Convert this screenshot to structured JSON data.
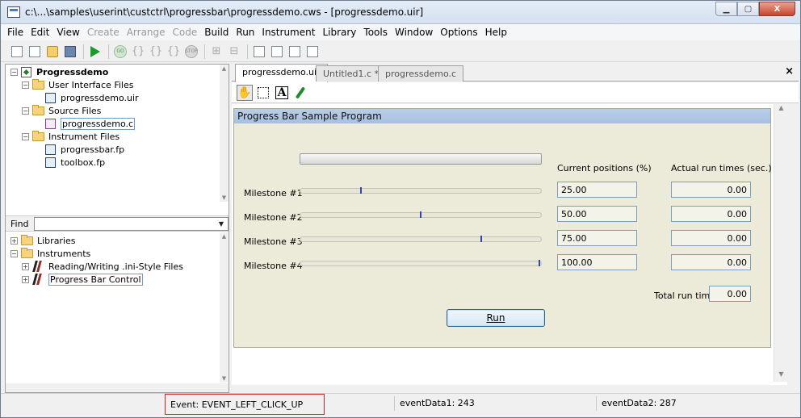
{
  "window": {
    "title": "c:\\...\\samples\\userint\\custctrl\\progressbar\\progressdemo.cws - [progressdemo.uir]",
    "controls": {
      "minimize": "▁",
      "maximize": "▢",
      "close": "X"
    }
  },
  "menu": [
    {
      "label": "File",
      "enabled": true
    },
    {
      "label": "Edit",
      "enabled": true
    },
    {
      "label": "View",
      "enabled": true
    },
    {
      "label": "Create",
      "enabled": false
    },
    {
      "label": "Arrange",
      "enabled": false
    },
    {
      "label": "Code",
      "enabled": false
    },
    {
      "label": "Build",
      "enabled": true
    },
    {
      "label": "Run",
      "enabled": true
    },
    {
      "label": "Instrument",
      "enabled": true
    },
    {
      "label": "Library",
      "enabled": true
    },
    {
      "label": "Tools",
      "enabled": true
    },
    {
      "label": "Window",
      "enabled": true
    },
    {
      "label": "Options",
      "enabled": true
    },
    {
      "label": "Help",
      "enabled": true
    }
  ],
  "project_tree": {
    "workspace": "Progressdemo",
    "folders": [
      {
        "label": "User Interface Files",
        "files": [
          "progressdemo.uir"
        ]
      },
      {
        "label": "Source Files",
        "files": [
          "progressdemo.c"
        ]
      },
      {
        "label": "Instrument Files",
        "files": [
          "progressbar.fp",
          "toolbox.fp"
        ]
      }
    ]
  },
  "find": {
    "label": "Find",
    "value": ""
  },
  "library_tree": {
    "items": [
      "Libraries",
      "Instruments"
    ],
    "instruments": [
      "Reading/Writing .ini-Style Files",
      "Progress Bar Control"
    ]
  },
  "tabs": [
    "progressdemo.uir",
    "Untitled1.c *",
    "progressdemo.c"
  ],
  "pane_close": "×",
  "panel": {
    "title": "Progress Bar Sample Program",
    "col_current": "Current positions (%)",
    "col_actual": "Actual run times (sec.)",
    "milestones": [
      {
        "label": "Milestone #1",
        "position": 25.0,
        "position_text": "25.00",
        "run_time": "0.00"
      },
      {
        "label": "Milestone #2",
        "position": 50.0,
        "position_text": "50.00",
        "run_time": "0.00"
      },
      {
        "label": "Milestone #3",
        "position": 75.0,
        "position_text": "75.00",
        "run_time": "0.00"
      },
      {
        "label": "Milestone #4",
        "position": 100.0,
        "position_text": "100.00",
        "run_time": "0.00"
      }
    ],
    "total_label": "Total run time:",
    "total_value": "0.00",
    "run_button": "Run"
  },
  "status": {
    "event": "Event: EVENT_LEFT_CLICK_UP",
    "eventData1": "eventData1: 243",
    "eventData2": "eventData2: 287"
  },
  "colors": {
    "milestone_marker": "#3049a8",
    "panel_bg": "#ecead9",
    "panel_title_bg": "#a8c0e0",
    "event_highlight": "#d02020"
  }
}
